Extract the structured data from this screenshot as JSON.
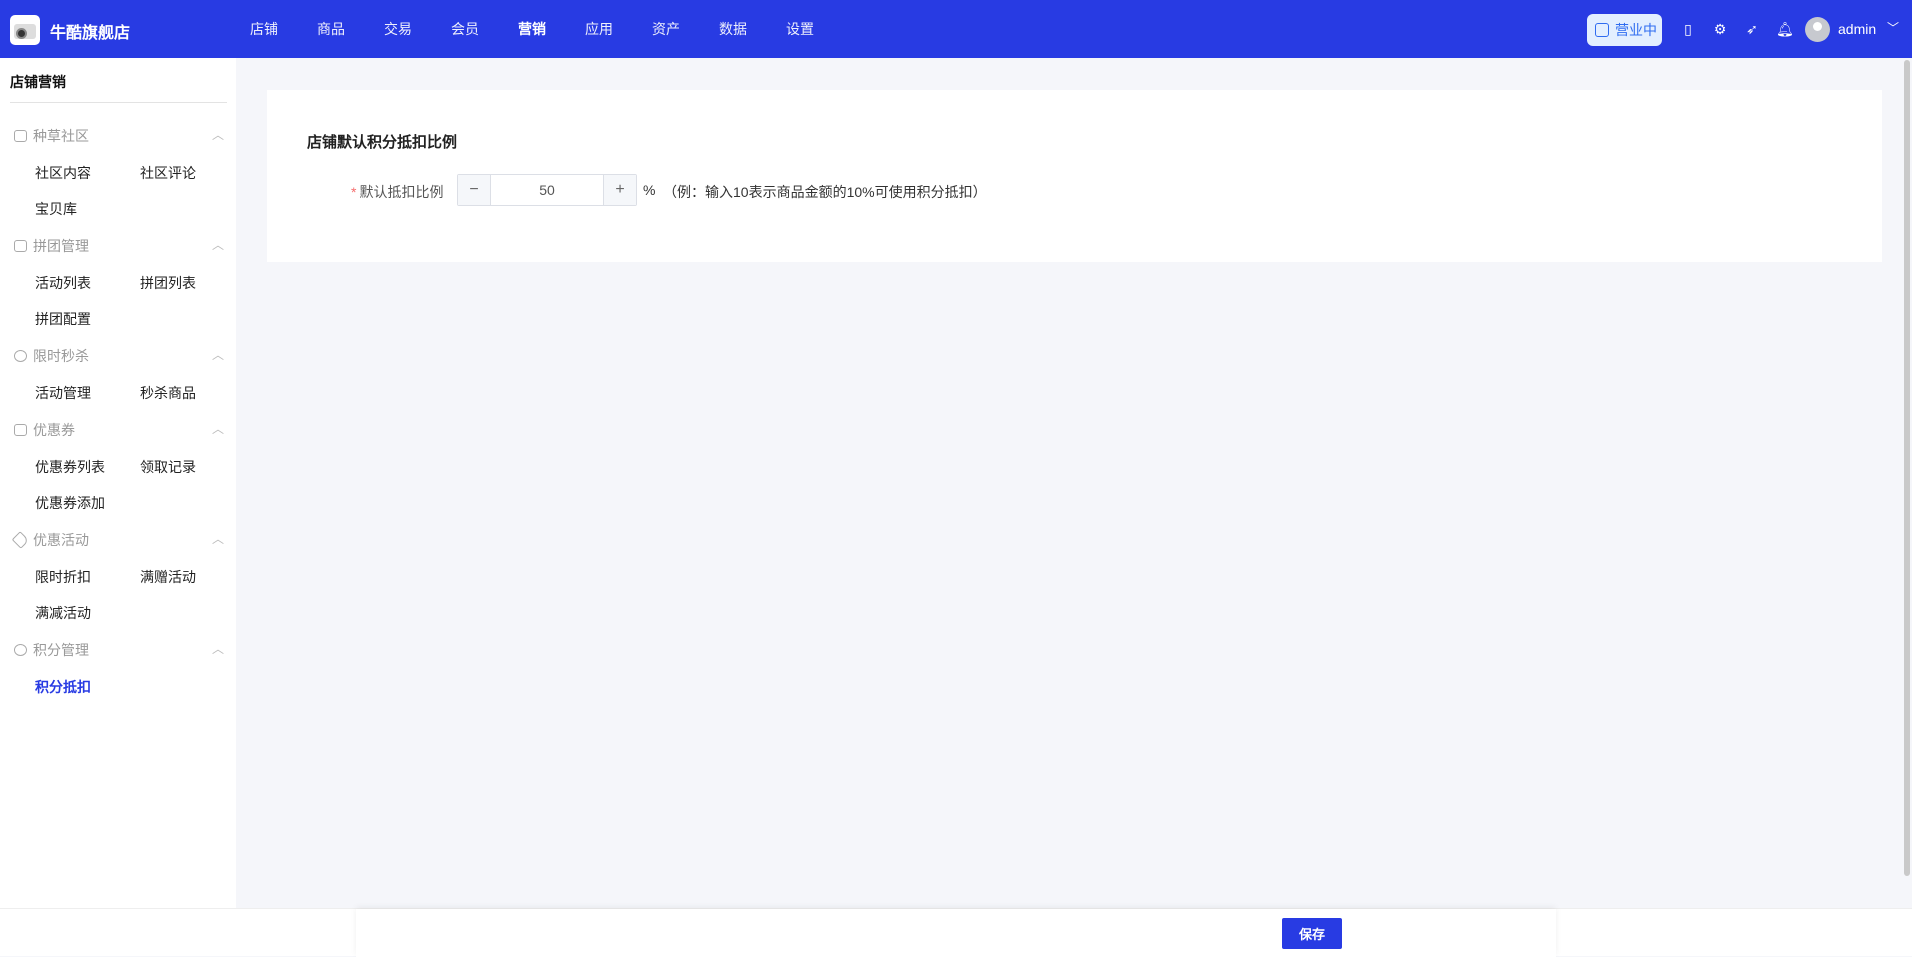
{
  "header": {
    "shop_name": "牛酷旗舰店",
    "nav": [
      "店铺",
      "商品",
      "交易",
      "会员",
      "营销",
      "应用",
      "资产",
      "数据",
      "设置"
    ],
    "active_nav": "营销",
    "status": "营业中",
    "user": "admin"
  },
  "sidebar": {
    "title": "店铺营销",
    "groups": [
      {
        "label": "种草社区",
        "items": [
          "社区内容",
          "社区评论",
          "宝贝库"
        ]
      },
      {
        "label": "拼团管理",
        "items": [
          "活动列表",
          "拼团列表",
          "拼团配置"
        ]
      },
      {
        "label": "限时秒杀",
        "items": [
          "活动管理",
          "秒杀商品"
        ]
      },
      {
        "label": "优惠券",
        "items": [
          "优惠券列表",
          "领取记录",
          "优惠券添加"
        ]
      },
      {
        "label": "优惠活动",
        "items": [
          "限时折扣",
          "满赠活动",
          "满减活动"
        ]
      },
      {
        "label": "积分管理",
        "items": [
          "积分抵扣"
        ]
      }
    ],
    "active_item": "积分抵扣"
  },
  "form": {
    "title": "店铺默认积分抵扣比例",
    "label": "默认抵扣比例",
    "required": "*",
    "value": "50",
    "minus": "−",
    "plus": "+",
    "unit": "%",
    "hint": "（例：输入10表示商品金额的10%可使用积分抵扣）"
  },
  "footer": {
    "save": "保存"
  }
}
